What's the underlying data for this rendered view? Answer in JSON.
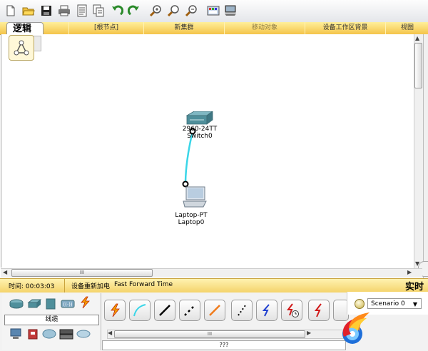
{
  "toolbar": {
    "buttons": [
      "new-file-icon",
      "open-folder-icon",
      "save-icon",
      "print-icon",
      "activity-wizard-icon",
      "copy-icon",
      "undo-icon",
      "redo-icon",
      "zoom-in-icon",
      "zoom-reset-icon",
      "zoom-out-icon",
      "palette-icon",
      "custom-device-icon"
    ]
  },
  "tabs": {
    "logic": "逻辑",
    "items": [
      "[根节点]",
      "新集群",
      "移动对象",
      "设备工作区背景",
      "视图"
    ]
  },
  "devices": {
    "switch": {
      "model": "2960-24TT",
      "name": "Switch0"
    },
    "laptop": {
      "model": "Laptop-PT",
      "name": "Laptop0"
    }
  },
  "scrollbar": {
    "grip": "III"
  },
  "status": {
    "time_label": "时间: 00:03:03",
    "power_cycle": "设备重新加电",
    "fast_forward": "Fast Forward Time",
    "realtime": "实时"
  },
  "bottom": {
    "category_label": "线缆",
    "connections_desc": "???",
    "scenario": "Scenario 0",
    "grip": "III"
  },
  "colors": {
    "tab_bar": "#f4c44a",
    "cable": "#3ad6e8",
    "status_bar": "#f4d36b"
  }
}
